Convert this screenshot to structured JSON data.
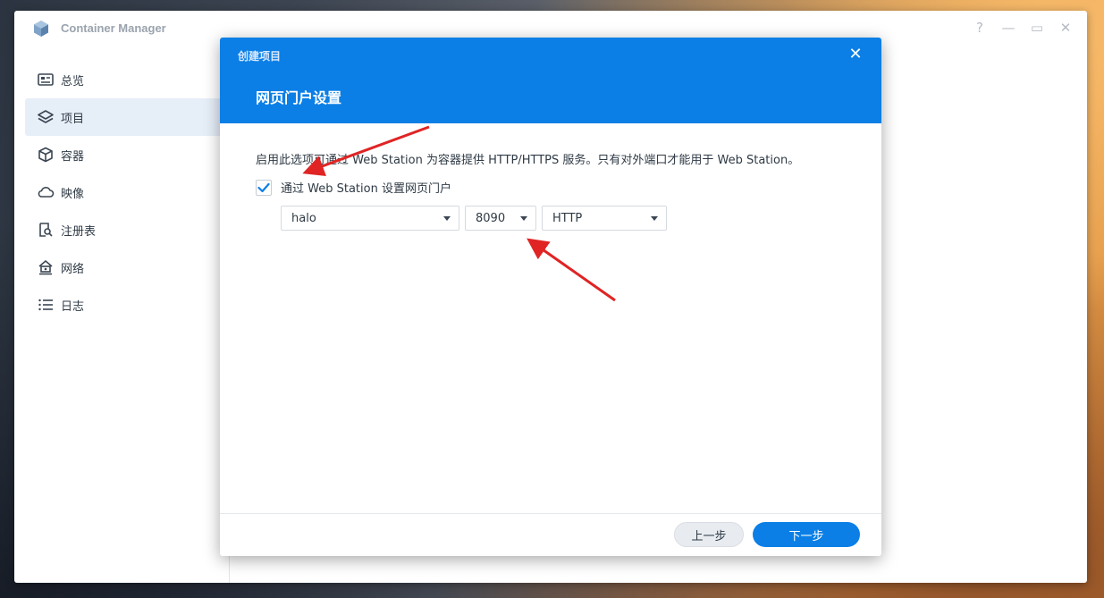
{
  "window": {
    "title": "Container Manager",
    "controls": [
      "?",
      "—",
      "▭",
      "✕"
    ]
  },
  "sidebar": {
    "items": [
      {
        "label": "总览",
        "icon": "dashboard-icon",
        "active": false
      },
      {
        "label": "项目",
        "icon": "layers-icon",
        "active": true
      },
      {
        "label": "容器",
        "icon": "cube-icon",
        "active": false
      },
      {
        "label": "映像",
        "icon": "cloud-icon",
        "active": false
      },
      {
        "label": "注册表",
        "icon": "registry-search-icon",
        "active": false
      },
      {
        "label": "网络",
        "icon": "network-house-icon",
        "active": false
      },
      {
        "label": "日志",
        "icon": "list-icon",
        "active": false
      }
    ]
  },
  "dialog": {
    "small_title": "创建项目",
    "title": "网页门户设置",
    "close": "✕",
    "description": "启用此选项可通过 Web Station 为容器提供 HTTP/HTTPS 服务。只有对外端口才能用于 Web Station。",
    "checkbox": {
      "label": "通过 Web Station 设置网页门户",
      "checked": true
    },
    "selects": {
      "service": "halo",
      "port": "8090",
      "protocol": "HTTP"
    },
    "buttons": {
      "prev": "上一步",
      "next": "下一步"
    }
  },
  "colors": {
    "accent": "#0b7fe6",
    "annotation_arrow": "#e02424",
    "sidebar_active": "#e6eef8"
  }
}
